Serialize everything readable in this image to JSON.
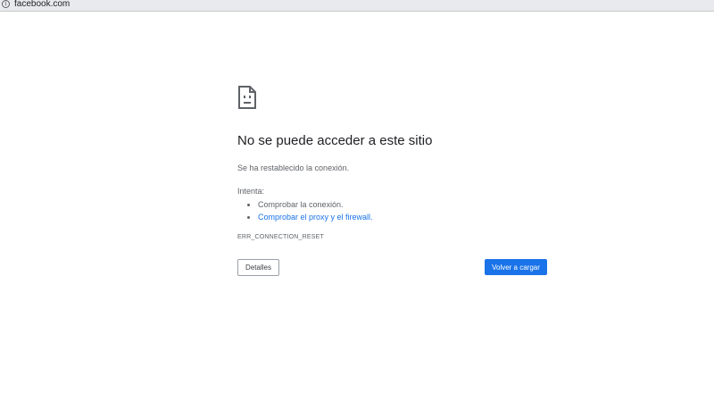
{
  "browser": {
    "url": "facebook.com",
    "info_icon": "info-icon"
  },
  "error_page": {
    "icon": "sad-page-icon",
    "heading": "No se puede acceder a este sitio",
    "summary": "Se ha restablecido la conexión.",
    "suggestions_title": "Intenta:",
    "suggestions": [
      "Comprobar la conexión.",
      "Comprobar el proxy y el firewall."
    ],
    "error_code": "ERR_CONNECTION_RESET",
    "details_button": "Detalles",
    "reload_button": "Volver a cargar"
  },
  "colors": {
    "accent": "#1a73e8",
    "text_primary": "#202124",
    "text_secondary": "#5f6368",
    "address_bar": "#e8eaed"
  }
}
